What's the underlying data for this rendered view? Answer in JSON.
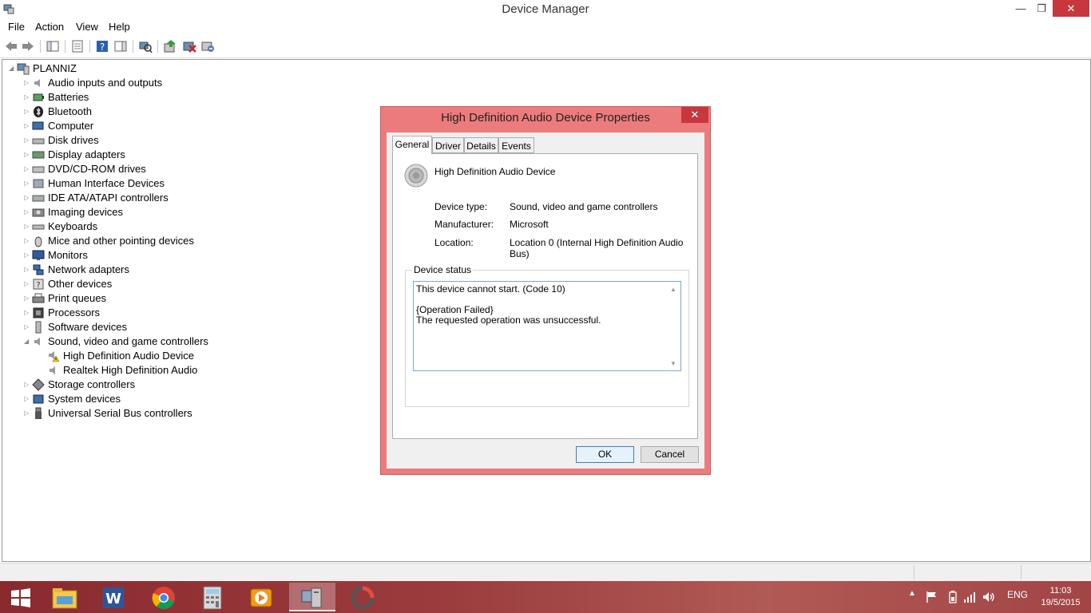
{
  "window": {
    "title": "Device Manager",
    "controls": {
      "minimize": "—",
      "maximize": "❐",
      "close": "✕"
    }
  },
  "menu": [
    "File",
    "Action",
    "View",
    "Help"
  ],
  "toolbar": {
    "icons": [
      "back-icon",
      "forward-icon",
      "show-hide-console-tree-icon",
      "properties-icon",
      "help-icon",
      "show-hide-action-pane-icon",
      "scan-hardware-icon",
      "update-driver-icon",
      "disable-device-icon",
      "uninstall-device-icon"
    ]
  },
  "tree": {
    "root": "PLANNIZ",
    "categories": [
      {
        "label": "Audio inputs and outputs",
        "icon": "speaker-icon",
        "expanded": false
      },
      {
        "label": "Batteries",
        "icon": "battery-icon",
        "expanded": false
      },
      {
        "label": "Bluetooth",
        "icon": "bluetooth-icon",
        "expanded": false
      },
      {
        "label": "Computer",
        "icon": "computer-icon",
        "expanded": false
      },
      {
        "label": "Disk drives",
        "icon": "disk-drive-icon",
        "expanded": false
      },
      {
        "label": "Display adapters",
        "icon": "display-adapter-icon",
        "expanded": false
      },
      {
        "label": "DVD/CD-ROM drives",
        "icon": "dvd-drive-icon",
        "expanded": false
      },
      {
        "label": "Human Interface Devices",
        "icon": "hid-icon",
        "expanded": false
      },
      {
        "label": "IDE ATA/ATAPI controllers",
        "icon": "ide-controller-icon",
        "expanded": false
      },
      {
        "label": "Imaging devices",
        "icon": "imaging-device-icon",
        "expanded": false
      },
      {
        "label": "Keyboards",
        "icon": "keyboard-icon",
        "expanded": false
      },
      {
        "label": "Mice and other pointing devices",
        "icon": "mouse-icon",
        "expanded": false
      },
      {
        "label": "Monitors",
        "icon": "monitor-icon",
        "expanded": false
      },
      {
        "label": "Network adapters",
        "icon": "network-adapter-icon",
        "expanded": false
      },
      {
        "label": "Other devices",
        "icon": "other-devices-icon",
        "expanded": false
      },
      {
        "label": "Print queues",
        "icon": "printer-icon",
        "expanded": false
      },
      {
        "label": "Processors",
        "icon": "processor-icon",
        "expanded": false
      },
      {
        "label": "Software devices",
        "icon": "software-device-icon",
        "expanded": false
      },
      {
        "label": "Sound, video and game controllers",
        "icon": "speaker-icon",
        "expanded": true,
        "children": [
          {
            "label": "High Definition Audio Device",
            "icon": "speaker-warning-icon"
          },
          {
            "label": "Realtek High Definition Audio",
            "icon": "speaker-icon"
          }
        ]
      },
      {
        "label": "Storage controllers",
        "icon": "storage-controller-icon",
        "expanded": false
      },
      {
        "label": "System devices",
        "icon": "system-device-icon",
        "expanded": false
      },
      {
        "label": "Universal Serial Bus controllers",
        "icon": "usb-icon",
        "expanded": false
      }
    ]
  },
  "dialog": {
    "title": "High Definition Audio Device Properties",
    "close": "✕",
    "tabs": [
      "General",
      "Driver",
      "Details",
      "Events"
    ],
    "active_tab": "General",
    "device_name": "High Definition Audio Device",
    "properties": [
      {
        "label": "Device type:",
        "value": "Sound, video and game controllers"
      },
      {
        "label": "Manufacturer:",
        "value": "Microsoft"
      },
      {
        "label": "Location:",
        "value": "Location 0 (Internal High Definition Audio Bus)"
      }
    ],
    "status_group": "Device status",
    "status_lines": [
      "This device cannot start. (Code 10)",
      "",
      "{Operation Failed}",
      "The requested operation was unsuccessful."
    ],
    "ok": "OK",
    "cancel": "Cancel"
  },
  "taskbar": {
    "apps": [
      "start-icon",
      "file-explorer-icon",
      "word-icon",
      "chrome-icon",
      "calculator-icon",
      "media-player-icon",
      "device-manager-icon",
      "app-icon"
    ],
    "active_app": "device-manager-icon",
    "language": "ENG",
    "time": "11:03",
    "date": "19/5/2015"
  },
  "colors": {
    "dialog_frame": "#ec7b7d",
    "close_red": "#c7383c",
    "taskbar": "#9b3b3d"
  }
}
